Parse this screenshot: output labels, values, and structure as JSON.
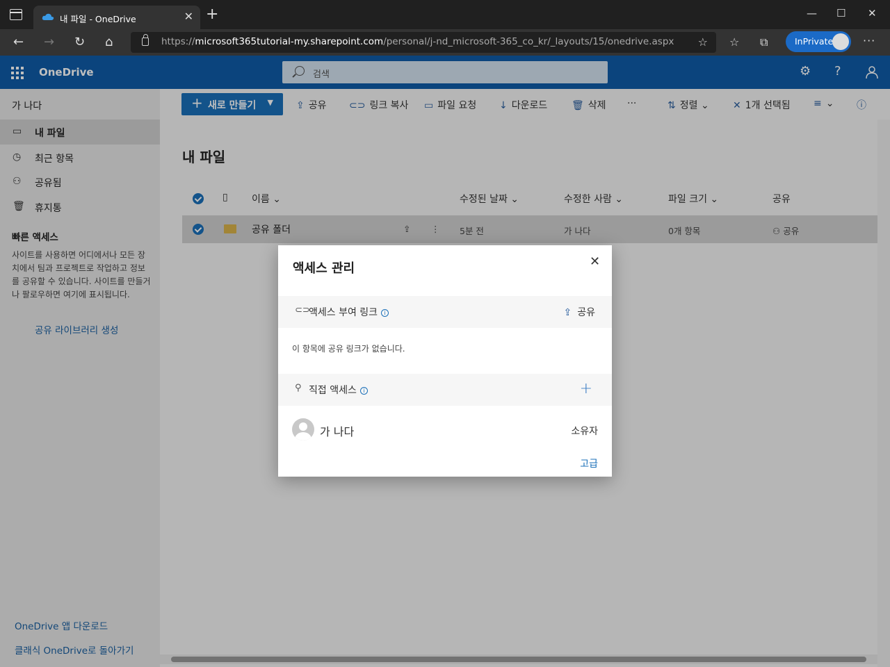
{
  "browser": {
    "tab_title": "내 파일 - OneDrive",
    "url_prefix": "https://",
    "url_host": "microsoft365tutorial-my.sharepoint.com",
    "url_path": "/personal/j-nd_microsoft-365_co_kr/_layouts/15/onedrive.aspx",
    "inprivate_label": "InPrivate"
  },
  "suite": {
    "brand": "OneDrive",
    "search_placeholder": "검색"
  },
  "leftnav": {
    "user": "가 나다",
    "items": [
      {
        "label": "내 파일",
        "icon": "folder-icon"
      },
      {
        "label": "최근 항목",
        "icon": "history-icon"
      },
      {
        "label": "공유됨",
        "icon": "people-icon"
      },
      {
        "label": "휴지통",
        "icon": "trash-icon"
      }
    ],
    "quick_access_title": "빠른 액세스",
    "quick_access_desc": "사이트를 사용하면 어디에서나 모든 장치에서 팀과 프로젝트로 작업하고 정보를 공유할 수 있습니다. 사이트를 만들거나 팔로우하면 여기에 표시됩니다.",
    "create_library_link": "공유 라이브러리 생성",
    "download_app_link": "OneDrive 앱 다운로드",
    "classic_link": "클래식 OneDrive로 돌아가기"
  },
  "cmdbar": {
    "new_label": "새로 만들기",
    "share": "공유",
    "copy_link": "링크 복사",
    "file_request": "파일 요청",
    "download": "다운로드",
    "delete": "삭제",
    "more": "···",
    "sort": "정렬",
    "selected": "1개 선택됨"
  },
  "main": {
    "title": "내 파일",
    "columns": {
      "name": "이름",
      "modified": "수정된 날짜",
      "modified_by": "수정한 사람",
      "size": "파일 크기",
      "sharing": "공유"
    },
    "row": {
      "name": "공유 폴더",
      "modified": "5분 전",
      "modified_by": "가 나다",
      "size": "0개 항목",
      "sharing": "공유"
    }
  },
  "dialog": {
    "title": "액세스 관리",
    "links_section": "액세스 부여 링크",
    "share_label": "공유",
    "no_links_msg": "이 항목에 공유 링크가 없습니다.",
    "direct_section": "직접 액세스",
    "person_name": "가 나다",
    "person_role": "소유자",
    "advanced": "고급"
  }
}
